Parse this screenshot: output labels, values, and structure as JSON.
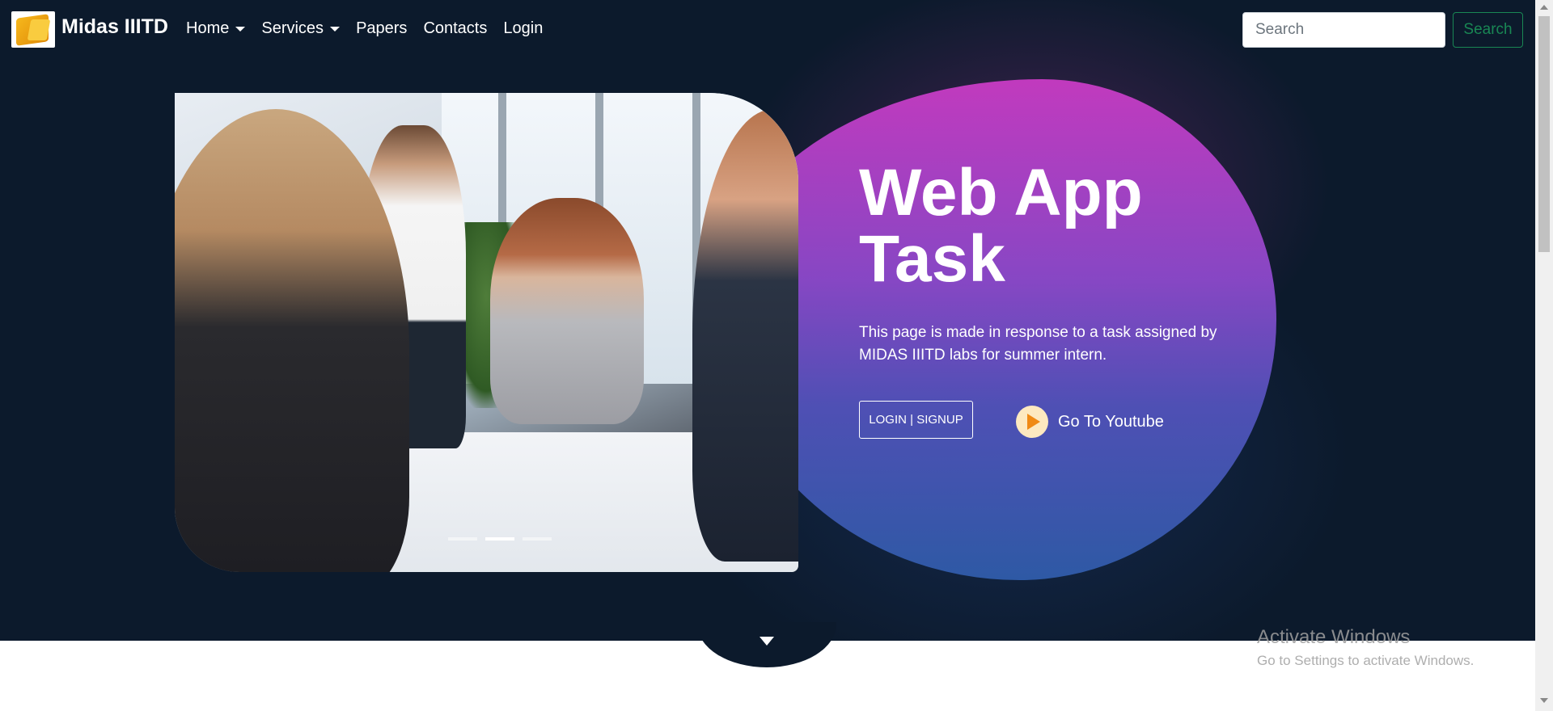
{
  "navbar": {
    "brand": "Midas IIITD",
    "items": [
      {
        "label": "Home",
        "dropdown": true
      },
      {
        "label": "Services",
        "dropdown": true
      },
      {
        "label": "Papers",
        "dropdown": false
      },
      {
        "label": "Contacts",
        "dropdown": false
      },
      {
        "label": "Login",
        "dropdown": false
      }
    ],
    "search": {
      "placeholder": "Search",
      "value": "",
      "button_label": "Search"
    }
  },
  "hero": {
    "title": "Web App Task",
    "description": "This page is made in response to a task assigned by MIDAS IIITD labs for summer intern.",
    "cta_label": "LOGIN | SIGNUP",
    "youtube_label": "Go To Youtube"
  },
  "carousel": {
    "slide_count": 3,
    "active_slide": 2
  },
  "watermark": {
    "title": "Activate Windows",
    "subtitle": "Go to Settings to activate Windows."
  },
  "colors": {
    "background": "#0c1a2c",
    "blob_top": "#c63bc2",
    "blob_bottom": "#2f5ba8",
    "search_button": "#198754",
    "play_icon": "#f08a14"
  }
}
